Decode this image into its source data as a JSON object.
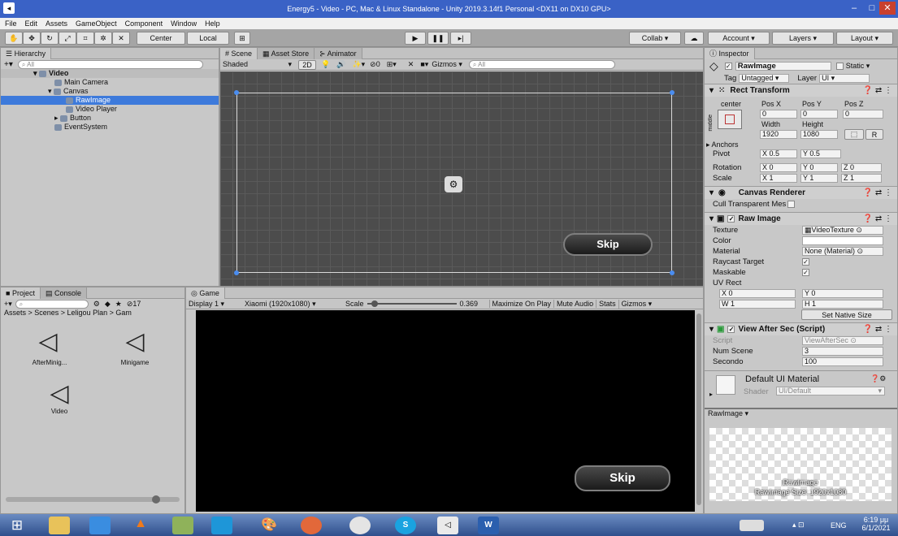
{
  "window": {
    "title": "Energy5 - Video - PC, Mac & Linux Standalone - Unity 2019.3.14f1 Personal <DX11 on DX10 GPU>",
    "minimize": "–",
    "maximize": "□",
    "close": "✕"
  },
  "menu": [
    "File",
    "Edit",
    "Assets",
    "GameObject",
    "Component",
    "Window",
    "Help"
  ],
  "toolbar": {
    "center": "Center",
    "local": "Local",
    "collab": "Collab ▾",
    "account": "Account",
    "layers": "Layers",
    "layout": "Layout"
  },
  "hierarchy": {
    "tab": "Hierarchy",
    "search": "All",
    "add": "+▾",
    "items": [
      {
        "label": "Video",
        "depth": 0
      },
      {
        "label": "Main Camera",
        "depth": 2
      },
      {
        "label": "Canvas",
        "depth": 1
      },
      {
        "label": "RawImage",
        "depth": 3
      },
      {
        "label": "Video Player",
        "depth": 2
      },
      {
        "label": "Button",
        "depth": 1
      },
      {
        "label": "EventSystem",
        "depth": 1
      }
    ],
    "selected": "RawImage"
  },
  "scene": {
    "tabs": [
      "Scene",
      "Asset Store",
      "Animator"
    ],
    "shading": "Shaded",
    "mode2d": "2D",
    "gizmos": "Gizmos",
    "search": "All",
    "skip": "Skip",
    "hidden_count": "0"
  },
  "project": {
    "tabs": [
      "Project",
      "Console"
    ],
    "breadcrumb": "Assets > Scenes > Leligou Plan > Gam",
    "count": "17",
    "assets": [
      "AfterMinig...",
      "Minigame",
      "Video"
    ]
  },
  "game": {
    "tab": "Game",
    "display": "Display 1",
    "resolution": "Xiaomi (1920x1080)",
    "scale_label": "Scale",
    "scale_value": "0.369",
    "maximize": "Maximize On Play",
    "mute": "Mute Audio",
    "stats": "Stats",
    "gizmos": "Gizmos",
    "skip": "Skip",
    "scale_fraction": 0.05
  },
  "inspector": {
    "tab": "Inspector",
    "object": "RawImage",
    "static": "Static",
    "tag_label": "Tag",
    "tag": "Untagged",
    "layer_label": "Layer",
    "layer": "UI",
    "rect": {
      "title": "Rect Transform",
      "anchor": "center",
      "anchor_side": "middle",
      "posx_label": "Pos X",
      "posy_label": "Pos Y",
      "posz_label": "Pos Z",
      "posx": "0",
      "posy": "0",
      "posz": "0",
      "width_label": "Width",
      "height_label": "Height",
      "width": "1920",
      "height": "1080",
      "r": "R",
      "anchors": "Anchors",
      "pivot": "Pivot",
      "pivot_x": "X 0.5",
      "pivot_y": "Y 0.5",
      "rotation": "Rotation",
      "rot_x": "X 0",
      "rot_y": "Y 0",
      "rot_z": "Z 0",
      "scale": "Scale",
      "scale_x": "X 1",
      "scale_y": "Y 1",
      "scale_z": "Z 1"
    },
    "canvas_renderer": {
      "title": "Canvas Renderer",
      "cull": "Cull Transparent Mes"
    },
    "raw_image": {
      "title": "Raw Image",
      "texture_label": "Texture",
      "texture": "VideoTexture",
      "color_label": "Color",
      "material_label": "Material",
      "material": "None (Material)",
      "raycast_label": "Raycast Target",
      "maskable_label": "Maskable",
      "uvrect_label": "UV Rect",
      "uv_x": "X 0",
      "uv_y": "Y 0",
      "uv_w": "W 1",
      "uv_h": "H 1",
      "native": "Set Native Size"
    },
    "script_comp": {
      "title": "View After Sec (Script)",
      "script_label": "Script",
      "script": "ViewAfterSec",
      "num_label": "Num Scene",
      "num": "3",
      "sec_label": "Secondo",
      "sec": "100"
    },
    "material": {
      "name": "Default UI Material",
      "shader_label": "Shader",
      "shader": "UI/Default"
    },
    "preview": {
      "dropdown": "RawImage ▾",
      "caption1": "RawImage",
      "caption2": "RawImage Size: 1920x1080"
    }
  },
  "taskbar": {
    "lang": "ENG",
    "time": "6:19 μμ",
    "date": "6/1/2021"
  },
  "colors": {
    "title_bar": "#3a62c6",
    "selection": "#3d7adb",
    "scene_bg": "#4c4c4c",
    "game_bg": "#000000"
  }
}
